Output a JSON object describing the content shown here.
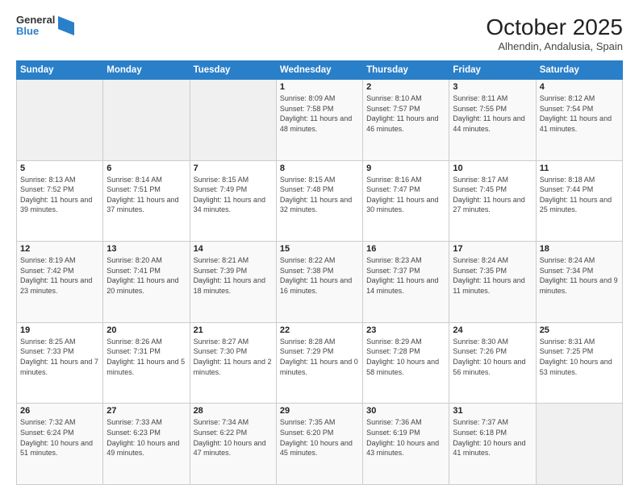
{
  "header": {
    "logo": {
      "line1": "General",
      "line2": "Blue"
    },
    "title": "October 2025",
    "subtitle": "Alhendin, Andalusia, Spain"
  },
  "weekdays": [
    "Sunday",
    "Monday",
    "Tuesday",
    "Wednesday",
    "Thursday",
    "Friday",
    "Saturday"
  ],
  "weeks": [
    [
      {
        "day": "",
        "empty": true
      },
      {
        "day": "",
        "empty": true
      },
      {
        "day": "",
        "empty": true
      },
      {
        "day": "1",
        "sunrise": "Sunrise: 8:09 AM",
        "sunset": "Sunset: 7:58 PM",
        "daylight": "Daylight: 11 hours and 48 minutes."
      },
      {
        "day": "2",
        "sunrise": "Sunrise: 8:10 AM",
        "sunset": "Sunset: 7:57 PM",
        "daylight": "Daylight: 11 hours and 46 minutes."
      },
      {
        "day": "3",
        "sunrise": "Sunrise: 8:11 AM",
        "sunset": "Sunset: 7:55 PM",
        "daylight": "Daylight: 11 hours and 44 minutes."
      },
      {
        "day": "4",
        "sunrise": "Sunrise: 8:12 AM",
        "sunset": "Sunset: 7:54 PM",
        "daylight": "Daylight: 11 hours and 41 minutes."
      }
    ],
    [
      {
        "day": "5",
        "sunrise": "Sunrise: 8:13 AM",
        "sunset": "Sunset: 7:52 PM",
        "daylight": "Daylight: 11 hours and 39 minutes."
      },
      {
        "day": "6",
        "sunrise": "Sunrise: 8:14 AM",
        "sunset": "Sunset: 7:51 PM",
        "daylight": "Daylight: 11 hours and 37 minutes."
      },
      {
        "day": "7",
        "sunrise": "Sunrise: 8:15 AM",
        "sunset": "Sunset: 7:49 PM",
        "daylight": "Daylight: 11 hours and 34 minutes."
      },
      {
        "day": "8",
        "sunrise": "Sunrise: 8:15 AM",
        "sunset": "Sunset: 7:48 PM",
        "daylight": "Daylight: 11 hours and 32 minutes."
      },
      {
        "day": "9",
        "sunrise": "Sunrise: 8:16 AM",
        "sunset": "Sunset: 7:47 PM",
        "daylight": "Daylight: 11 hours and 30 minutes."
      },
      {
        "day": "10",
        "sunrise": "Sunrise: 8:17 AM",
        "sunset": "Sunset: 7:45 PM",
        "daylight": "Daylight: 11 hours and 27 minutes."
      },
      {
        "day": "11",
        "sunrise": "Sunrise: 8:18 AM",
        "sunset": "Sunset: 7:44 PM",
        "daylight": "Daylight: 11 hours and 25 minutes."
      }
    ],
    [
      {
        "day": "12",
        "sunrise": "Sunrise: 8:19 AM",
        "sunset": "Sunset: 7:42 PM",
        "daylight": "Daylight: 11 hours and 23 minutes."
      },
      {
        "day": "13",
        "sunrise": "Sunrise: 8:20 AM",
        "sunset": "Sunset: 7:41 PM",
        "daylight": "Daylight: 11 hours and 20 minutes."
      },
      {
        "day": "14",
        "sunrise": "Sunrise: 8:21 AM",
        "sunset": "Sunset: 7:39 PM",
        "daylight": "Daylight: 11 hours and 18 minutes."
      },
      {
        "day": "15",
        "sunrise": "Sunrise: 8:22 AM",
        "sunset": "Sunset: 7:38 PM",
        "daylight": "Daylight: 11 hours and 16 minutes."
      },
      {
        "day": "16",
        "sunrise": "Sunrise: 8:23 AM",
        "sunset": "Sunset: 7:37 PM",
        "daylight": "Daylight: 11 hours and 14 minutes."
      },
      {
        "day": "17",
        "sunrise": "Sunrise: 8:24 AM",
        "sunset": "Sunset: 7:35 PM",
        "daylight": "Daylight: 11 hours and 11 minutes."
      },
      {
        "day": "18",
        "sunrise": "Sunrise: 8:24 AM",
        "sunset": "Sunset: 7:34 PM",
        "daylight": "Daylight: 11 hours and 9 minutes."
      }
    ],
    [
      {
        "day": "19",
        "sunrise": "Sunrise: 8:25 AM",
        "sunset": "Sunset: 7:33 PM",
        "daylight": "Daylight: 11 hours and 7 minutes."
      },
      {
        "day": "20",
        "sunrise": "Sunrise: 8:26 AM",
        "sunset": "Sunset: 7:31 PM",
        "daylight": "Daylight: 11 hours and 5 minutes."
      },
      {
        "day": "21",
        "sunrise": "Sunrise: 8:27 AM",
        "sunset": "Sunset: 7:30 PM",
        "daylight": "Daylight: 11 hours and 2 minutes."
      },
      {
        "day": "22",
        "sunrise": "Sunrise: 8:28 AM",
        "sunset": "Sunset: 7:29 PM",
        "daylight": "Daylight: 11 hours and 0 minutes."
      },
      {
        "day": "23",
        "sunrise": "Sunrise: 8:29 AM",
        "sunset": "Sunset: 7:28 PM",
        "daylight": "Daylight: 10 hours and 58 minutes."
      },
      {
        "day": "24",
        "sunrise": "Sunrise: 8:30 AM",
        "sunset": "Sunset: 7:26 PM",
        "daylight": "Daylight: 10 hours and 56 minutes."
      },
      {
        "day": "25",
        "sunrise": "Sunrise: 8:31 AM",
        "sunset": "Sunset: 7:25 PM",
        "daylight": "Daylight: 10 hours and 53 minutes."
      }
    ],
    [
      {
        "day": "26",
        "sunrise": "Sunrise: 7:32 AM",
        "sunset": "Sunset: 6:24 PM",
        "daylight": "Daylight: 10 hours and 51 minutes."
      },
      {
        "day": "27",
        "sunrise": "Sunrise: 7:33 AM",
        "sunset": "Sunset: 6:23 PM",
        "daylight": "Daylight: 10 hours and 49 minutes."
      },
      {
        "day": "28",
        "sunrise": "Sunrise: 7:34 AM",
        "sunset": "Sunset: 6:22 PM",
        "daylight": "Daylight: 10 hours and 47 minutes."
      },
      {
        "day": "29",
        "sunrise": "Sunrise: 7:35 AM",
        "sunset": "Sunset: 6:20 PM",
        "daylight": "Daylight: 10 hours and 45 minutes."
      },
      {
        "day": "30",
        "sunrise": "Sunrise: 7:36 AM",
        "sunset": "Sunset: 6:19 PM",
        "daylight": "Daylight: 10 hours and 43 minutes."
      },
      {
        "day": "31",
        "sunrise": "Sunrise: 7:37 AM",
        "sunset": "Sunset: 6:18 PM",
        "daylight": "Daylight: 10 hours and 41 minutes."
      },
      {
        "day": "",
        "empty": true
      }
    ]
  ]
}
